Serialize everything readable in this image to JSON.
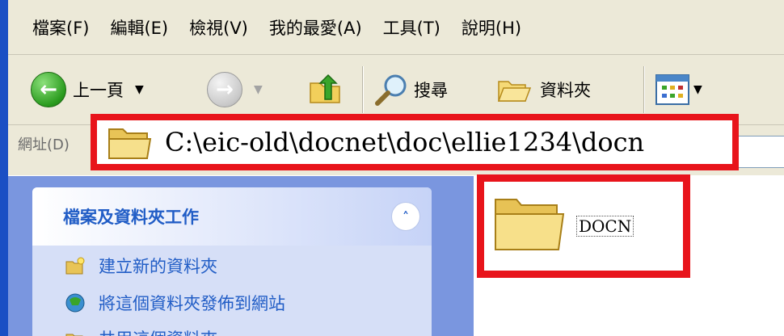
{
  "menubar": {
    "items": [
      "檔案(F)",
      "編輯(E)",
      "檢視(V)",
      "我的最愛(A)",
      "工具(T)",
      "說明(H)"
    ]
  },
  "toolbar": {
    "back_label": "上一頁",
    "search_label": "搜尋",
    "folders_label": "資料夾",
    "icons": {
      "back": "back-arrow-icon",
      "forward": "forward-arrow-icon",
      "up": "up-folder-icon",
      "search": "search-magnifier-icon",
      "folders": "folders-icon",
      "views": "views-grid-icon"
    }
  },
  "addressbar": {
    "label": "網址(D)",
    "path": "C:\\eic-old\\docnet\\doc\\ellie1234\\docn"
  },
  "taskpane": {
    "title": "檔案及資料夾工作",
    "items": [
      {
        "label": "建立新的資料夾",
        "icon": "new-folder-icon"
      },
      {
        "label": "將這個資料夾發佈到網站",
        "icon": "publish-web-icon"
      },
      {
        "label": "共用這個資料夾",
        "icon": "share-folder-icon"
      }
    ]
  },
  "content": {
    "folder_name": "DOCN"
  },
  "colors": {
    "highlight_red": "#e8141b",
    "xp_toolbar": "#ece9d8",
    "task_link_blue": "#215dc6",
    "task_pane_bg": "#7a96df"
  }
}
